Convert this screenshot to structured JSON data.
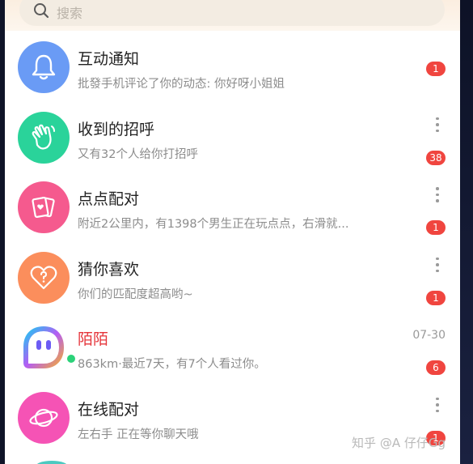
{
  "search": {
    "placeholder": "搜索"
  },
  "items": [
    {
      "title": "互动通知",
      "subtitle": "批發手机评论了你的动态: 你好呀小姐姐",
      "badge": "1",
      "avatar_color": "#6a9bf5",
      "icon": "bell-icon"
    },
    {
      "title": "收到的招呼",
      "subtitle": "又有32个人给你打招呼",
      "badge": "38",
      "avatar_color": "#2ad39a",
      "icon": "wave-hand-icon"
    },
    {
      "title": "点点配对",
      "subtitle": "附近2公里内，有1398个男生正在玩点点，右滑就...",
      "badge": "1",
      "avatar_color": "#f55a8e",
      "icon": "cards-icon"
    },
    {
      "title": "猜你喜欢",
      "subtitle": "你们的匹配度超高哟~",
      "badge": "1",
      "avatar_color": "#fb8e5c",
      "icon": "heart-question-icon"
    },
    {
      "title": "陌陌",
      "subtitle": "863km·最近7天，有7个人看过你。",
      "badge": "6",
      "time": "07-30",
      "icon": "momo-logo-icon"
    },
    {
      "title": "在线配对",
      "subtitle": "左右手 正在等你聊天哦",
      "badge": "1",
      "avatar_color": "#f553b5",
      "icon": "planet-icon"
    }
  ],
  "watermark": "知乎 @A 仔仔Gg"
}
